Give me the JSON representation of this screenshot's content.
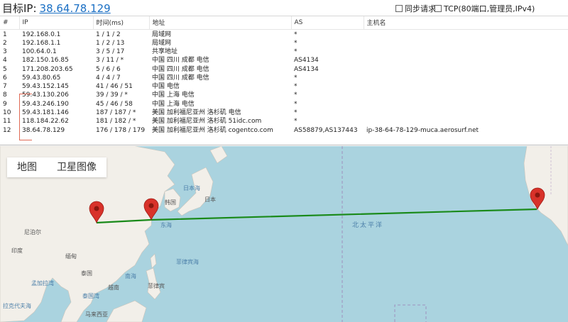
{
  "header": {
    "target_label": "目标IP:",
    "target_ip": "38.64.78.129",
    "sync_label": "同步请求",
    "tcp_label": "TCP(80端口,管理员,IPv4)"
  },
  "table": {
    "columns": [
      "#",
      "IP",
      "时间(ms)",
      "地址",
      "AS",
      "主机名"
    ],
    "rows": [
      [
        "1",
        "192.168.0.1",
        "1 / 1 / 2",
        "局域网",
        "*",
        ""
      ],
      [
        "2",
        "192.168.1.1",
        "1 / 2 / 13",
        "局域网",
        "*",
        ""
      ],
      [
        "3",
        "100.64.0.1",
        "3 / 5 / 17",
        "共享地址",
        "*",
        ""
      ],
      [
        "4",
        "182.150.16.85",
        "3 / 11 / *",
        "中国 四川 成都 电信",
        "AS4134",
        ""
      ],
      [
        "5",
        "171.208.203.65",
        "5 / 6 / 6",
        "中国 四川 成都 电信",
        "AS4134",
        ""
      ],
      [
        "6",
        "59.43.80.65",
        "4 / 4 / 7",
        "中国 四川 成都 电信",
        "*",
        ""
      ],
      [
        "7",
        "59.43.152.145",
        "41 / 46 / 51",
        "中国 电信",
        "*",
        ""
      ],
      [
        "8",
        "59.43.130.206",
        "39 / 39 / *",
        "中国 上海 电信",
        "*",
        ""
      ],
      [
        "9",
        "59.43.246.190",
        "45 / 46 / 58",
        "中国 上海 电信",
        "*",
        ""
      ],
      [
        "10",
        "59.43.181.146",
        "187 / 187 / *",
        "美国 加利福尼亚州 洛杉矶 电信",
        "*",
        ""
      ],
      [
        "11",
        "118.184.22.62",
        "181 / 182 / *",
        "美国 加利福尼亚州 洛杉矶 51idc.com",
        "*",
        ""
      ],
      [
        "12",
        "38.64.78.129",
        "176 / 178 / 179",
        "美国 加利福尼亚州 洛杉矶 cogentco.com",
        "AS58879,AS137443",
        "ip-38-64-78-129-muca.aerosurf.net"
      ]
    ]
  },
  "map": {
    "tabs": [
      "地图",
      "卫星图像"
    ],
    "labels": {
      "japan_sea": "日本海",
      "korea": "韩国",
      "japan": "日本",
      "east_sea": "东海",
      "pacific": "北太平洋",
      "nepal": "尼泊尔",
      "india": "印度",
      "myanmar": "缅甸",
      "thailand": "泰国",
      "south_sea": "南海",
      "philippine_sea": "菲律宾海",
      "bengal": "孟加拉湾",
      "vietnam": "越南",
      "philippines": "菲律宾",
      "thai_gulf": "泰国湾",
      "laccadive": "拉克代夫海",
      "malaysia": "马来西亚"
    },
    "colors": {
      "land": "#f2efe9",
      "water": "#aad3df",
      "route": "#1a8a1a",
      "pin": "#d8322a"
    }
  }
}
